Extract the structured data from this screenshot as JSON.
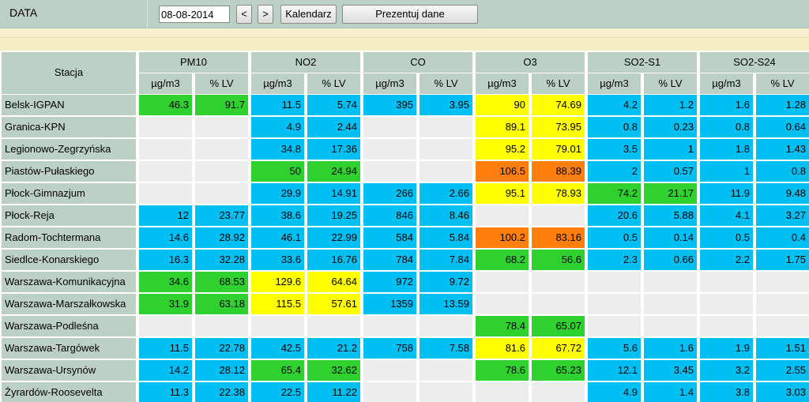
{
  "toolbar": {
    "date_label": "DATA",
    "date_value": "08-08-2014",
    "prev_label": "<",
    "next_label": ">",
    "calendar_label": "Kalendarz",
    "show_label": "Prezentuj dane"
  },
  "table": {
    "station_header": "Stacja",
    "groups": [
      "PM10",
      "NO2",
      "CO",
      "O3",
      "SO2-S1",
      "SO2-S24"
    ],
    "unit_header": "µg/m3",
    "lv_header": "% LV",
    "colors": {
      "blue": "#00bff3",
      "green": "#2fd12f",
      "yellow": "#ffff00",
      "orange": "#ff7f0e",
      "empty": "#ededed",
      "header": "#bdd0c6"
    },
    "rows": [
      {
        "station": "Belsk-IGPAN",
        "cells": [
          [
            "46.3",
            "91.7",
            "green"
          ],
          [
            "11.5",
            "5.74",
            "blue"
          ],
          [
            "395",
            "3.95",
            "blue"
          ],
          [
            "90",
            "74.69",
            "yellow"
          ],
          [
            "4.2",
            "1.2",
            "blue"
          ],
          [
            "1.6",
            "1.28",
            "blue"
          ]
        ]
      },
      {
        "station": "Granica-KPN",
        "cells": [
          [
            "",
            "",
            "empty"
          ],
          [
            "4.9",
            "2.44",
            "blue"
          ],
          [
            "",
            "",
            "empty"
          ],
          [
            "89.1",
            "73.95",
            "yellow"
          ],
          [
            "0.8",
            "0.23",
            "blue"
          ],
          [
            "0.8",
            "0.64",
            "blue"
          ]
        ]
      },
      {
        "station": "Legionowo-Zegrzyńska",
        "cells": [
          [
            "",
            "",
            "empty"
          ],
          [
            "34.8",
            "17.36",
            "blue"
          ],
          [
            "",
            "",
            "empty"
          ],
          [
            "95.2",
            "79.01",
            "yellow"
          ],
          [
            "3.5",
            "1",
            "blue"
          ],
          [
            "1.8",
            "1.43",
            "blue"
          ]
        ]
      },
      {
        "station": "Piastów-Pułaskiego",
        "cells": [
          [
            "",
            "",
            "empty"
          ],
          [
            "50",
            "24.94",
            "green"
          ],
          [
            "",
            "",
            "empty"
          ],
          [
            "106.5",
            "88.39",
            "orange"
          ],
          [
            "2",
            "0.57",
            "blue"
          ],
          [
            "1",
            "0.8",
            "blue"
          ]
        ]
      },
      {
        "station": "Płock-Gimnazjum",
        "cells": [
          [
            "",
            "",
            "empty"
          ],
          [
            "29.9",
            "14.91",
            "blue"
          ],
          [
            "266",
            "2.66",
            "blue"
          ],
          [
            "95.1",
            "78.93",
            "yellow"
          ],
          [
            "74.2",
            "21.17",
            "green"
          ],
          [
            "11.9",
            "9.48",
            "blue"
          ]
        ]
      },
      {
        "station": "Płock-Reja",
        "cells": [
          [
            "12",
            "23.77",
            "blue"
          ],
          [
            "38.6",
            "19.25",
            "blue"
          ],
          [
            "846",
            "8.46",
            "blue"
          ],
          [
            "",
            "",
            "empty"
          ],
          [
            "20.6",
            "5.88",
            "blue"
          ],
          [
            "4.1",
            "3.27",
            "blue"
          ]
        ]
      },
      {
        "station": "Radom-Tochtermana",
        "cells": [
          [
            "14.6",
            "28.92",
            "blue"
          ],
          [
            "46.1",
            "22.99",
            "blue"
          ],
          [
            "584",
            "5.84",
            "blue"
          ],
          [
            "100.2",
            "83.16",
            "orange"
          ],
          [
            "0.5",
            "0.14",
            "blue"
          ],
          [
            "0.5",
            "0.4",
            "blue"
          ]
        ]
      },
      {
        "station": "Siedlce-Konarskiego",
        "cells": [
          [
            "16.3",
            "32.28",
            "blue"
          ],
          [
            "33.6",
            "16.76",
            "blue"
          ],
          [
            "784",
            "7.84",
            "blue"
          ],
          [
            "68.2",
            "56.6",
            "green"
          ],
          [
            "2.3",
            "0.66",
            "blue"
          ],
          [
            "2.2",
            "1.75",
            "blue"
          ]
        ]
      },
      {
        "station": "Warszawa-Komunikacyjna",
        "cells": [
          [
            "34.6",
            "68.53",
            "green"
          ],
          [
            "129.6",
            "64.64",
            "yellow"
          ],
          [
            "972",
            "9.72",
            "blue"
          ],
          [
            "",
            "",
            "empty"
          ],
          [
            "",
            "",
            "empty"
          ],
          [
            "",
            "",
            "empty"
          ]
        ]
      },
      {
        "station": "Warszawa-Marszałkowska",
        "cells": [
          [
            "31.9",
            "63.18",
            "green"
          ],
          [
            "115.5",
            "57.61",
            "yellow"
          ],
          [
            "1359",
            "13.59",
            "blue"
          ],
          [
            "",
            "",
            "empty"
          ],
          [
            "",
            "",
            "empty"
          ],
          [
            "",
            "",
            "empty"
          ]
        ]
      },
      {
        "station": "Warszawa-Podleśna",
        "cells": [
          [
            "",
            "",
            "empty"
          ],
          [
            "",
            "",
            "empty"
          ],
          [
            "",
            "",
            "empty"
          ],
          [
            "78.4",
            "65.07",
            "green"
          ],
          [
            "",
            "",
            "empty"
          ],
          [
            "",
            "",
            "empty"
          ]
        ]
      },
      {
        "station": "Warszawa-Targówek",
        "cells": [
          [
            "11.5",
            "22.78",
            "blue"
          ],
          [
            "42.5",
            "21.2",
            "blue"
          ],
          [
            "758",
            "7.58",
            "blue"
          ],
          [
            "81.6",
            "67.72",
            "yellow"
          ],
          [
            "5.6",
            "1.6",
            "blue"
          ],
          [
            "1.9",
            "1.51",
            "blue"
          ]
        ]
      },
      {
        "station": "Warszawa-Ursynów",
        "cells": [
          [
            "14.2",
            "28.12",
            "blue"
          ],
          [
            "65.4",
            "32.62",
            "green"
          ],
          [
            "",
            "",
            "empty"
          ],
          [
            "78.6",
            "65.23",
            "green"
          ],
          [
            "12.1",
            "3.45",
            "blue"
          ],
          [
            "3.2",
            "2.55",
            "blue"
          ]
        ]
      },
      {
        "station": "Żyrardów-Roosevelta",
        "cells": [
          [
            "11.3",
            "22.38",
            "blue"
          ],
          [
            "22.5",
            "11.22",
            "blue"
          ],
          [
            "",
            "",
            "empty"
          ],
          [
            "",
            "",
            "empty"
          ],
          [
            "4.9",
            "1.4",
            "blue"
          ],
          [
            "3.8",
            "3.03",
            "blue"
          ]
        ]
      }
    ]
  }
}
